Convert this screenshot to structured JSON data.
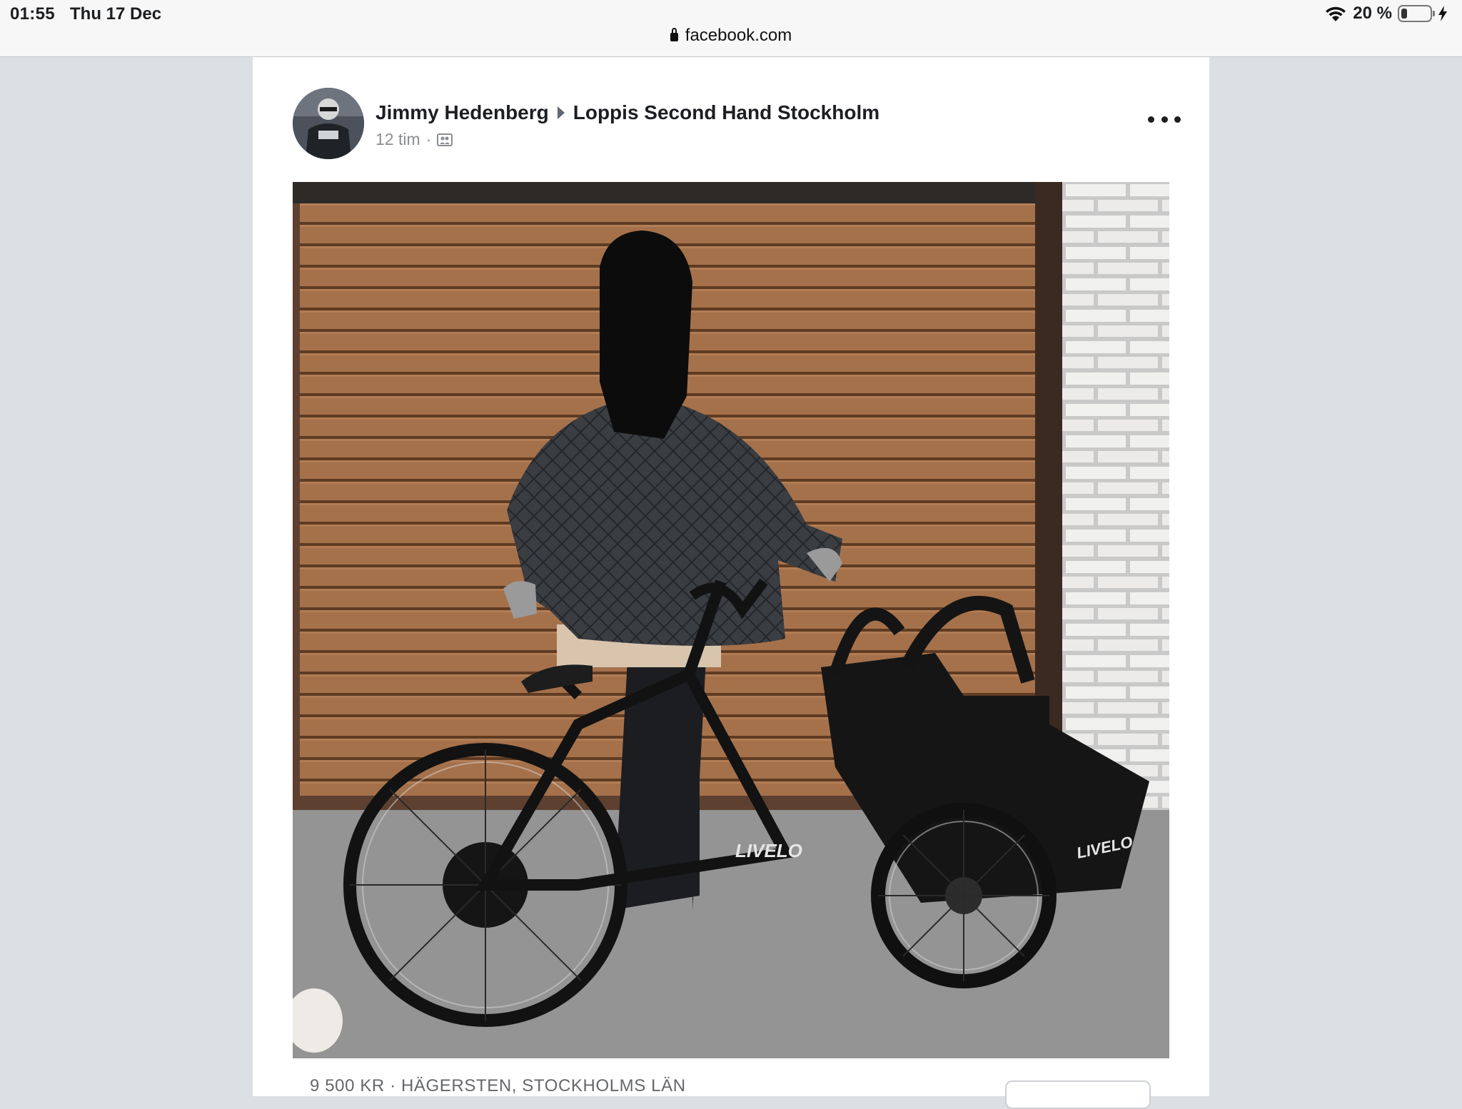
{
  "status_bar": {
    "time": "01:55",
    "date": "Thu 17 Dec",
    "battery_text": "20 %",
    "battery_level": 0.2
  },
  "browser": {
    "url": "facebook.com"
  },
  "post": {
    "author": "Jimmy Hedenberg",
    "group": "Loppis Second Hand Stockholm",
    "time": "12 tim",
    "separator": "·",
    "image_text": "LIVELO",
    "listing": "9 500 KR · HÄGERSTEN, STOCKHOLMS LÄN"
  },
  "icons": {
    "lock": "lock-icon",
    "wifi": "wifi-icon",
    "battery": "battery-icon",
    "charging": "bolt-icon",
    "audience": "group-icon",
    "more": "more-dots-icon"
  }
}
